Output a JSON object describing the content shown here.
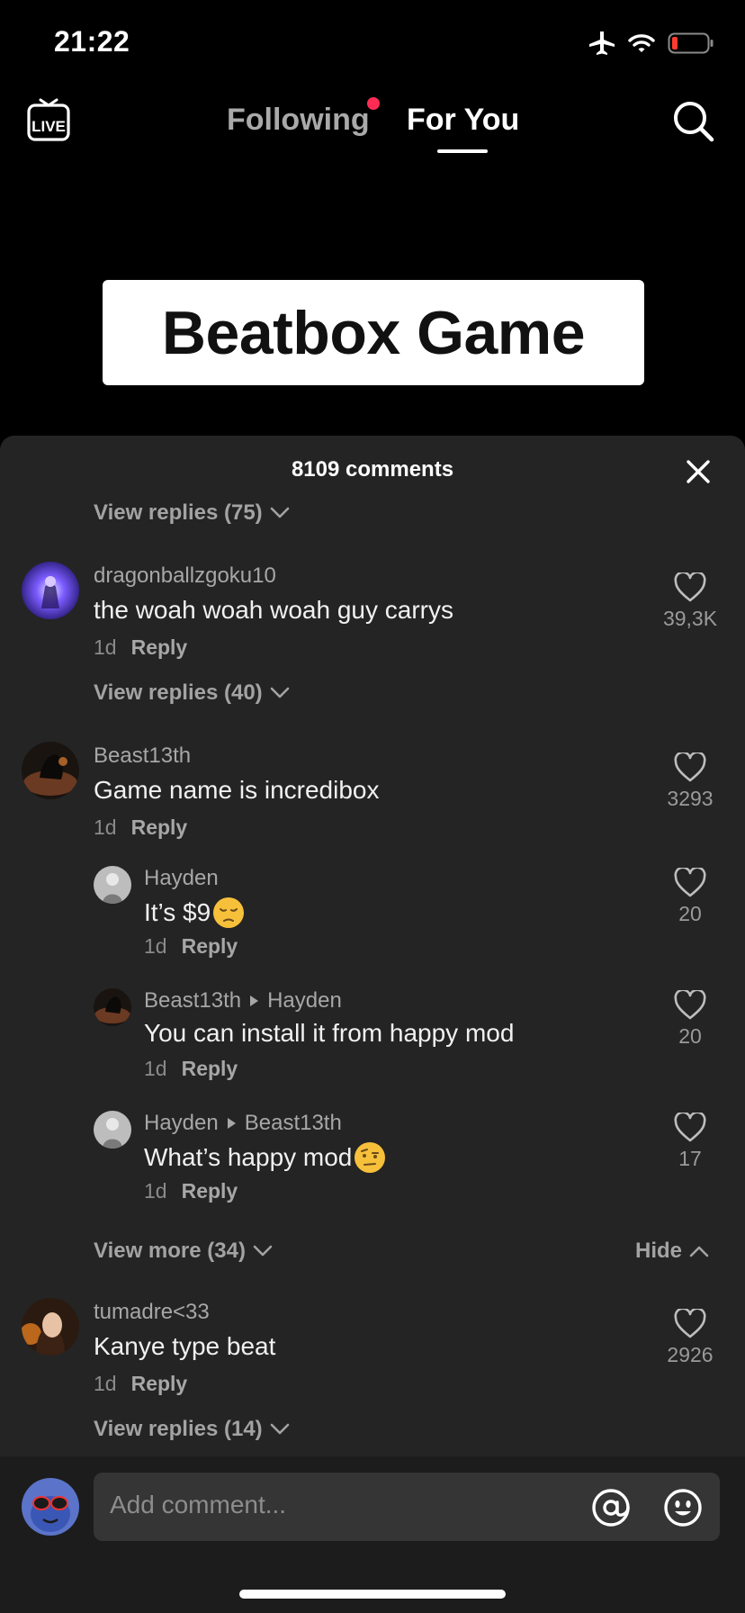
{
  "status": {
    "time": "21:22"
  },
  "nav": {
    "live_label": "LIVE",
    "following": "Following",
    "for_you": "For You"
  },
  "video": {
    "title_card": "Beatbox Game"
  },
  "comments_sheet": {
    "count_label": "8109 comments",
    "top_view_replies": "View replies (75)",
    "comments": [
      {
        "user": "dragonballzgoku10",
        "text": "the woah woah woah guy carrys",
        "time": "1d",
        "reply": "Reply",
        "likes": "39,3K",
        "view_replies": "View replies (40)"
      },
      {
        "user": "Beast13th",
        "text": "Game name is incredibox",
        "time": "1d",
        "reply": "Reply",
        "likes": "3293",
        "replies": [
          {
            "user": "Hayden",
            "text": "It’s $9",
            "time": "1d",
            "reply": "Reply",
            "likes": "20"
          },
          {
            "user": "Beast13th",
            "to": "Hayden",
            "text": "You can install it from happy mod",
            "time": "1d",
            "reply": "Reply",
            "likes": "20"
          },
          {
            "user": "Hayden",
            "to": "Beast13th",
            "text": "What’s happy mod",
            "time": "1d",
            "reply": "Reply",
            "likes": "17"
          }
        ],
        "view_more": "View more (34)",
        "hide": "Hide"
      },
      {
        "user": "tumadre<33",
        "text": "Kanye type beat",
        "time": "1d",
        "reply": "Reply",
        "likes": "2926",
        "view_replies": "View replies (14)"
      }
    ]
  },
  "input": {
    "placeholder": "Add comment..."
  },
  "colors": {
    "accent": "#fe2c55",
    "sheet_bg": "#242424",
    "input_bg": "#353535"
  },
  "icons": [
    "live-icon",
    "search-icon",
    "close-icon",
    "heart-icon",
    "chevron-down-icon",
    "chevron-up-icon",
    "at-icon",
    "emoji-icon",
    "airplane-icon",
    "wifi-icon",
    "battery-icon"
  ]
}
